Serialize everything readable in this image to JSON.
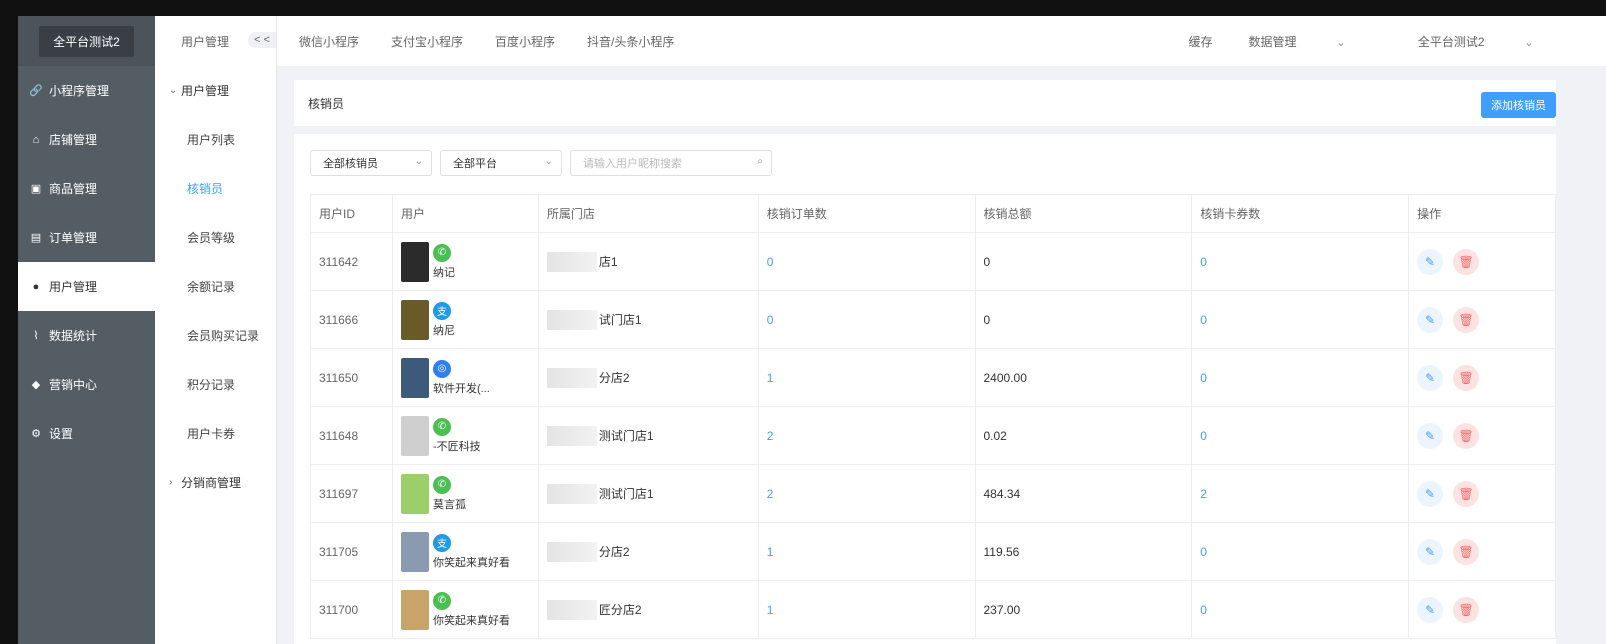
{
  "brand": "全平台测试2",
  "sidebar": [
    {
      "label": "小程序管理",
      "icon": "link-icon"
    },
    {
      "label": "店铺管理",
      "icon": "shop-icon"
    },
    {
      "label": "商品管理",
      "icon": "goods-icon"
    },
    {
      "label": "订单管理",
      "icon": "order-icon"
    },
    {
      "label": "用户管理",
      "icon": "user-icon",
      "active": true
    },
    {
      "label": "数据统计",
      "icon": "chart-icon"
    },
    {
      "label": "营销中心",
      "icon": "marketing-icon"
    },
    {
      "label": "设置",
      "icon": "settings-icon"
    }
  ],
  "subnav": {
    "title": "用户管理",
    "collapse": "< <",
    "group_label": "用户管理",
    "items": [
      "用户列表",
      "核销员",
      "会员等级",
      "余额记录",
      "会员购买记录",
      "积分记录",
      "用户卡券"
    ],
    "group2_label": "分销商管理"
  },
  "topbar": {
    "tabs": [
      "微信小程序",
      "支付宝小程序",
      "百度小程序",
      "抖音/头条小程序"
    ],
    "cache": "缓存",
    "data_manage": "数据管理",
    "account": "全平台测试2"
  },
  "header": {
    "title": "核销员",
    "add_button": "添加核销员"
  },
  "filters": {
    "verifier_select": "全部核销员",
    "platform_select": "全部平台",
    "search_placeholder": "请输入用户昵称搜索"
  },
  "table": {
    "columns": [
      "用户ID",
      "用户",
      "所属门店",
      "核销订单数",
      "核销总额",
      "核销卡券数",
      "操作"
    ],
    "rows": [
      {
        "id": "311642",
        "platform": "wechat",
        "name": "纳记",
        "store": "店1",
        "orders": "0",
        "total": "0",
        "coupons": "0"
      },
      {
        "id": "311666",
        "platform": "alipay",
        "name": "纳尼",
        "store": "试门店1",
        "orders": "0",
        "total": "0",
        "coupons": "0"
      },
      {
        "id": "311650",
        "platform": "baidu",
        "name": "软件开发(...",
        "store": "分店2",
        "orders": "1",
        "total": "2400.00",
        "coupons": "0"
      },
      {
        "id": "311648",
        "platform": "wechat",
        "name": "-不匠科技",
        "store": "测试门店1",
        "orders": "2",
        "total": "0.02",
        "coupons": "0"
      },
      {
        "id": "311697",
        "platform": "wechat",
        "name": "莫言孤",
        "store": "测试门店1",
        "orders": "2",
        "total": "484.34",
        "coupons": "2"
      },
      {
        "id": "311705",
        "platform": "alipay",
        "name": "你笑起来真好看",
        "store": "分店2",
        "orders": "1",
        "total": "119.56",
        "coupons": "0"
      },
      {
        "id": "311700",
        "platform": "wechat",
        "name": "你笑起来真好看",
        "store": "匠分店2",
        "orders": "1",
        "total": "237.00",
        "coupons": "0"
      }
    ]
  },
  "colors": {
    "accent": "#409eff",
    "sidebar": "#545c64",
    "wechat": "#4cbf52",
    "alipay": "#1c9be8",
    "baidu": "#2f7ff0",
    "danger": "#f56c6c"
  }
}
